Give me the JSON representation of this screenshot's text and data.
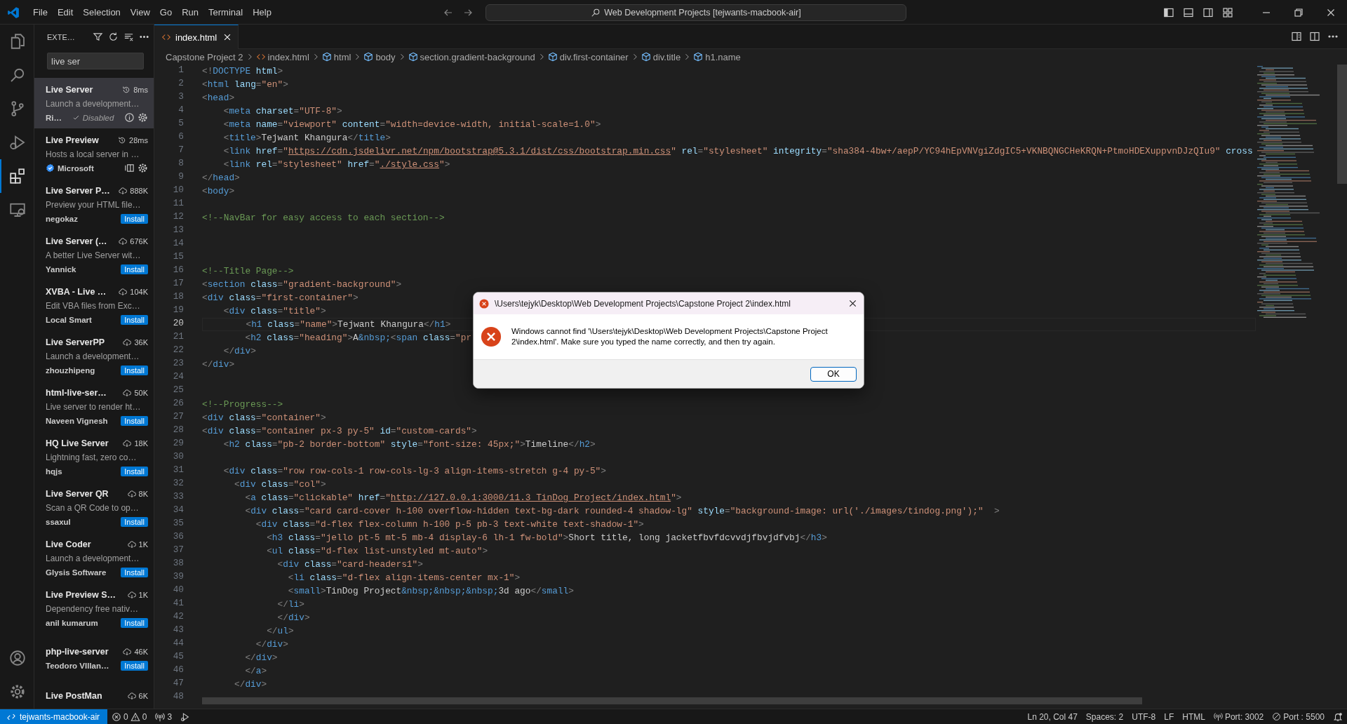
{
  "title_bar": {
    "menu": [
      "File",
      "Edit",
      "Selection",
      "View",
      "Go",
      "Run",
      "Terminal",
      "Help"
    ],
    "command_center": "Web Development Projects [tejwants-macbook-air]"
  },
  "activity_bar": [
    {
      "kind": "explorer",
      "selected": false
    },
    {
      "kind": "search",
      "selected": false
    },
    {
      "kind": "source-control",
      "selected": false
    },
    {
      "kind": "run-debug",
      "selected": false
    },
    {
      "kind": "extensions",
      "selected": true
    },
    {
      "kind": "remote",
      "selected": false
    }
  ],
  "activity_bar_bottom": [
    {
      "kind": "accounts"
    },
    {
      "kind": "settings"
    }
  ],
  "sidebar": {
    "title": "EXTE…",
    "search": {
      "value": "live ser"
    },
    "extensions": [
      {
        "name": "Live Server",
        "stat": "8ms",
        "description": "Launch a development…",
        "publisher": "Ri…",
        "kind": "disabled",
        "action": "Disabled",
        "selected": true,
        "verified": false
      },
      {
        "name": "Live Preview",
        "stat": "28ms",
        "description": "Hosts a local server in …",
        "publisher": "Microsoft",
        "kind": "installed",
        "selected": false,
        "verified": true
      },
      {
        "name": "Live Server P…",
        "stat": "888K",
        "description": "Preview your HTML file…",
        "publisher": "negokaz",
        "kind": "marketplace",
        "action": "Install",
        "selected": false,
        "verified": false
      },
      {
        "name": "Live Server (…",
        "stat": "676K",
        "description": "A better Live Server wit…",
        "publisher": "Yannick",
        "kind": "marketplace",
        "action": "Install",
        "selected": false,
        "verified": false
      },
      {
        "name": "XVBA - Live …",
        "stat": "104K",
        "description": "Edit VBA files from Exc…",
        "publisher": "Local Smart",
        "kind": "marketplace",
        "action": "Install",
        "selected": false,
        "verified": false
      },
      {
        "name": "Live ServerPP",
        "stat": "36K",
        "description": "Launch a development…",
        "publisher": "zhouzhipeng",
        "kind": "marketplace",
        "action": "Install",
        "selected": false,
        "verified": false
      },
      {
        "name": "html-live-ser…",
        "stat": "50K",
        "description": "Live server to render ht…",
        "publisher": "Naveen Vignesh",
        "kind": "marketplace",
        "action": "Install",
        "selected": false,
        "verified": false
      },
      {
        "name": "HQ Live Server",
        "stat": "18K",
        "description": "Lightning fast, zero co…",
        "publisher": "hqjs",
        "kind": "marketplace",
        "action": "Install",
        "selected": false,
        "verified": false
      },
      {
        "name": "Live Server QR",
        "stat": "8K",
        "description": "Scan a QR Code to op…",
        "publisher": "ssaxul",
        "kind": "marketplace",
        "action": "Install",
        "selected": false,
        "verified": false
      },
      {
        "name": "Live Coder",
        "stat": "1K",
        "description": "Launch a development…",
        "publisher": "Glysis Software",
        "kind": "marketplace",
        "action": "Install",
        "selected": false,
        "verified": false
      },
      {
        "name": "Live Preview S…",
        "stat": "1K",
        "description": "Dependency free nativ…",
        "publisher": "anil kumarum",
        "kind": "marketplace",
        "action": "Install",
        "selected": false,
        "verified": false
      },
      {
        "name": "php-live-server",
        "stat": "46K",
        "publisher": "Teodoro VIllan…",
        "kind": "marketplace",
        "action": "Install",
        "selected": false,
        "verified": false
      },
      {
        "name": "Live PostMan",
        "stat": "6K",
        "kind": "marketplace",
        "selected": false
      }
    ]
  },
  "editor": {
    "tab": {
      "label": "index.html",
      "selected": true
    },
    "breadcrumb": [
      {
        "kind": "folder",
        "label": "Capstone Project 2"
      },
      {
        "kind": "file",
        "label": "index.html"
      },
      {
        "kind": "symbol",
        "label": "html"
      },
      {
        "kind": "symbol",
        "label": "body"
      },
      {
        "kind": "symbol",
        "label": "section.gradient-background"
      },
      {
        "kind": "symbol",
        "label": "div.first-container"
      },
      {
        "kind": "symbol",
        "label": "div.title"
      },
      {
        "kind": "symbol",
        "label": "h1.name"
      }
    ],
    "lines": [
      {
        "number": "1",
        "current": false,
        "tokens": [
          {
            "kind": "punct",
            "text": "<!"
          },
          {
            "kind": "tag",
            "text": "DOCTYPE "
          },
          {
            "kind": "attr",
            "text": "html"
          },
          {
            "kind": "punct",
            "text": ">"
          }
        ]
      },
      {
        "number": "2",
        "current": false,
        "tokens": [
          {
            "kind": "punct",
            "text": "<"
          },
          {
            "kind": "tag",
            "text": "html "
          },
          {
            "kind": "attr",
            "text": "lang"
          },
          {
            "kind": "punct",
            "text": "="
          },
          {
            "kind": "string",
            "text": "\"en\""
          },
          {
            "kind": "punct",
            "text": ">"
          }
        ]
      },
      {
        "number": "3",
        "current": false,
        "tokens": [
          {
            "kind": "punct",
            "text": "<"
          },
          {
            "kind": "tag",
            "text": "head"
          },
          {
            "kind": "punct",
            "text": ">"
          }
        ]
      },
      {
        "number": "4",
        "current": false,
        "tokens": [
          {
            "kind": "punct",
            "text": "    <"
          },
          {
            "kind": "tag",
            "text": "meta "
          },
          {
            "kind": "attr",
            "text": "charset"
          },
          {
            "kind": "punct",
            "text": "="
          },
          {
            "kind": "string",
            "text": "\"UTF-8\""
          },
          {
            "kind": "punct",
            "text": ">"
          }
        ]
      },
      {
        "number": "5",
        "current": false,
        "tokens": [
          {
            "kind": "punct",
            "text": "    <"
          },
          {
            "kind": "tag",
            "text": "meta "
          },
          {
            "kind": "attr",
            "text": "name"
          },
          {
            "kind": "punct",
            "text": "="
          },
          {
            "kind": "string",
            "text": "\"viewport\" "
          },
          {
            "kind": "attr",
            "text": "content"
          },
          {
            "kind": "punct",
            "text": "="
          },
          {
            "kind": "string",
            "text": "\"width=device-width, initial-scale=1.0\""
          },
          {
            "kind": "punct",
            "text": ">"
          }
        ]
      },
      {
        "number": "6",
        "current": false,
        "tokens": [
          {
            "kind": "punct",
            "text": "    <"
          },
          {
            "kind": "tag",
            "text": "title"
          },
          {
            "kind": "punct",
            "text": ">"
          },
          {
            "kind": "text",
            "text": "Tejwant Khangura"
          },
          {
            "kind": "punct",
            "text": "</"
          },
          {
            "kind": "tag",
            "text": "title"
          },
          {
            "kind": "punct",
            "text": ">"
          }
        ]
      },
      {
        "number": "7",
        "current": false,
        "tokens": [
          {
            "kind": "punct",
            "text": "    <"
          },
          {
            "kind": "tag",
            "text": "link "
          },
          {
            "kind": "attr",
            "text": "href"
          },
          {
            "kind": "punct",
            "text": "="
          },
          {
            "kind": "string",
            "text": "\""
          },
          {
            "kind": "link",
            "text": "https://cdn.jsdelivr.net/npm/bootstrap@5.3.1/dist/css/bootstrap.min.css"
          },
          {
            "kind": "string",
            "text": "\" "
          },
          {
            "kind": "attr",
            "text": "rel"
          },
          {
            "kind": "punct",
            "text": "="
          },
          {
            "kind": "string",
            "text": "\"stylesheet\" "
          },
          {
            "kind": "attr",
            "text": "integrity"
          },
          {
            "kind": "punct",
            "text": "="
          },
          {
            "kind": "string",
            "text": "\"sha384-4bw+/aepP/YC94hEpVNVgiZdgIC5+VKNBQNGCHeKRQN+PtmoHDEXuppvnDJzQIu9\" "
          },
          {
            "kind": "attr",
            "text": "cross"
          }
        ]
      },
      {
        "number": "8",
        "current": false,
        "tokens": [
          {
            "kind": "punct",
            "text": "    <"
          },
          {
            "kind": "tag",
            "text": "link "
          },
          {
            "kind": "attr",
            "text": "rel"
          },
          {
            "kind": "punct",
            "text": "="
          },
          {
            "kind": "string",
            "text": "\"stylesheet\" "
          },
          {
            "kind": "attr",
            "text": "href"
          },
          {
            "kind": "punct",
            "text": "="
          },
          {
            "kind": "string",
            "text": "\""
          },
          {
            "kind": "link",
            "text": "./style.css"
          },
          {
            "kind": "string",
            "text": "\""
          },
          {
            "kind": "punct",
            "text": ">"
          }
        ]
      },
      {
        "number": "9",
        "current": false,
        "tokens": [
          {
            "kind": "punct",
            "text": "</"
          },
          {
            "kind": "tag",
            "text": "head"
          },
          {
            "kind": "punct",
            "text": ">"
          }
        ]
      },
      {
        "number": "10",
        "current": false,
        "tokens": [
          {
            "kind": "punct",
            "text": "<"
          },
          {
            "kind": "tag",
            "text": "body"
          },
          {
            "kind": "punct",
            "text": ">"
          }
        ]
      },
      {
        "number": "11",
        "current": false
      },
      {
        "number": "12",
        "current": false,
        "tokens": [
          {
            "kind": "comment",
            "text": "<!--NavBar for easy access to each section-->"
          }
        ]
      },
      {
        "number": "13",
        "current": false
      },
      {
        "number": "14",
        "current": false
      },
      {
        "number": "15",
        "current": false
      },
      {
        "number": "16",
        "current": false,
        "tokens": [
          {
            "kind": "comment",
            "text": "<!--Title Page-->"
          }
        ]
      },
      {
        "number": "17",
        "current": false,
        "tokens": [
          {
            "kind": "punct",
            "text": "<"
          },
          {
            "kind": "tag",
            "text": "section "
          },
          {
            "kind": "attr",
            "text": "class"
          },
          {
            "kind": "punct",
            "text": "="
          },
          {
            "kind": "string",
            "text": "\"gradient-background\""
          },
          {
            "kind": "punct",
            "text": ">"
          }
        ]
      },
      {
        "number": "18",
        "current": false,
        "tokens": [
          {
            "kind": "punct",
            "text": "<"
          },
          {
            "kind": "tag",
            "text": "div "
          },
          {
            "kind": "attr",
            "text": "class"
          },
          {
            "kind": "punct",
            "text": "="
          },
          {
            "kind": "string",
            "text": "\"first-container\""
          },
          {
            "kind": "punct",
            "text": ">"
          }
        ]
      },
      {
        "number": "19",
        "current": false,
        "tokens": [
          {
            "kind": "punct",
            "text": "    <"
          },
          {
            "kind": "tag",
            "text": "div "
          },
          {
            "kind": "attr",
            "text": "class"
          },
          {
            "kind": "punct",
            "text": "="
          },
          {
            "kind": "string",
            "text": "\"title\""
          },
          {
            "kind": "punct",
            "text": ">"
          }
        ]
      },
      {
        "number": "20",
        "current": true,
        "tokens": [
          {
            "kind": "punct",
            "text": "        <"
          },
          {
            "kind": "tag",
            "text": "h1 "
          },
          {
            "kind": "attr",
            "text": "class"
          },
          {
            "kind": "punct",
            "text": "="
          },
          {
            "kind": "string",
            "text": "\"name\""
          },
          {
            "kind": "punct",
            "text": ">"
          },
          {
            "kind": "text",
            "text": "Tejwant Khangura"
          },
          {
            "kind": "punct",
            "text": "</"
          },
          {
            "kind": "tag",
            "text": "h1"
          },
          {
            "kind": "punct",
            "text": ">"
          }
        ]
      },
      {
        "number": "21",
        "current": false,
        "tokens": [
          {
            "kind": "punct",
            "text": "        <"
          },
          {
            "kind": "tag",
            "text": "h2 "
          },
          {
            "kind": "attr",
            "text": "class"
          },
          {
            "kind": "punct",
            "text": "="
          },
          {
            "kind": "string",
            "text": "\"heading\""
          },
          {
            "kind": "punct",
            "text": ">"
          },
          {
            "kind": "text",
            "text": "A"
          },
          {
            "kind": "entity",
            "text": "&nbsp;"
          },
          {
            "kind": "punct",
            "text": "<"
          },
          {
            "kind": "tag",
            "text": "span "
          },
          {
            "kind": "attr",
            "text": "class"
          },
          {
            "kind": "punct",
            "text": "="
          },
          {
            "kind": "string",
            "text": "\"pr"
          }
        ]
      },
      {
        "number": "22",
        "current": false,
        "tokens": [
          {
            "kind": "punct",
            "text": "    </"
          },
          {
            "kind": "tag",
            "text": "div"
          },
          {
            "kind": "punct",
            "text": ">"
          }
        ]
      },
      {
        "number": "23",
        "current": false,
        "tokens": [
          {
            "kind": "punct",
            "text": "</"
          },
          {
            "kind": "tag",
            "text": "div"
          },
          {
            "kind": "punct",
            "text": ">"
          }
        ]
      },
      {
        "number": "24",
        "current": false
      },
      {
        "number": "25",
        "current": false
      },
      {
        "number": "26",
        "current": false,
        "tokens": [
          {
            "kind": "comment",
            "text": "<!--Progress-->"
          }
        ]
      },
      {
        "number": "27",
        "current": false,
        "tokens": [
          {
            "kind": "punct",
            "text": "<"
          },
          {
            "kind": "tag",
            "text": "div "
          },
          {
            "kind": "attr",
            "text": "class"
          },
          {
            "kind": "punct",
            "text": "="
          },
          {
            "kind": "string",
            "text": "\"container\""
          },
          {
            "kind": "punct",
            "text": ">"
          }
        ]
      },
      {
        "number": "28",
        "current": false,
        "tokens": [
          {
            "kind": "punct",
            "text": "<"
          },
          {
            "kind": "tag",
            "text": "div "
          },
          {
            "kind": "attr",
            "text": "class"
          },
          {
            "kind": "punct",
            "text": "="
          },
          {
            "kind": "string",
            "text": "\"container px-3 py-5\" "
          },
          {
            "kind": "attr",
            "text": "id"
          },
          {
            "kind": "punct",
            "text": "="
          },
          {
            "kind": "string",
            "text": "\"custom-cards\""
          },
          {
            "kind": "punct",
            "text": ">"
          }
        ]
      },
      {
        "number": "29",
        "current": false,
        "tokens": [
          {
            "kind": "punct",
            "text": "    <"
          },
          {
            "kind": "tag",
            "text": "h2 "
          },
          {
            "kind": "attr",
            "text": "class"
          },
          {
            "kind": "punct",
            "text": "="
          },
          {
            "kind": "string",
            "text": "\"pb-2 border-bottom\" "
          },
          {
            "kind": "attr",
            "text": "style"
          },
          {
            "kind": "punct",
            "text": "="
          },
          {
            "kind": "string",
            "text": "\"font-size: 45px;\""
          },
          {
            "kind": "punct",
            "text": ">"
          },
          {
            "kind": "text",
            "text": "Timeline"
          },
          {
            "kind": "punct",
            "text": "</"
          },
          {
            "kind": "tag",
            "text": "h2"
          },
          {
            "kind": "punct",
            "text": ">"
          }
        ]
      },
      {
        "number": "30",
        "current": false
      },
      {
        "number": "31",
        "current": false,
        "tokens": [
          {
            "kind": "punct",
            "text": "    <"
          },
          {
            "kind": "tag",
            "text": "div "
          },
          {
            "kind": "attr",
            "text": "class"
          },
          {
            "kind": "punct",
            "text": "="
          },
          {
            "kind": "string",
            "text": "\"row row-cols-1 row-cols-lg-3 align-items-stretch g-4 py-5\""
          },
          {
            "kind": "punct",
            "text": ">"
          }
        ]
      },
      {
        "number": "32",
        "current": false,
        "tokens": [
          {
            "kind": "punct",
            "text": "      <"
          },
          {
            "kind": "tag",
            "text": "div "
          },
          {
            "kind": "attr",
            "text": "class"
          },
          {
            "kind": "punct",
            "text": "="
          },
          {
            "kind": "string",
            "text": "\"col\""
          },
          {
            "kind": "punct",
            "text": ">"
          }
        ]
      },
      {
        "number": "33",
        "current": false,
        "tokens": [
          {
            "kind": "punct",
            "text": "        <"
          },
          {
            "kind": "tag",
            "text": "a "
          },
          {
            "kind": "attr",
            "text": "class"
          },
          {
            "kind": "punct",
            "text": "="
          },
          {
            "kind": "string",
            "text": "\"clickable\" "
          },
          {
            "kind": "attr",
            "text": "href"
          },
          {
            "kind": "punct",
            "text": "="
          },
          {
            "kind": "string",
            "text": "\""
          },
          {
            "kind": "link",
            "text": "http://127.0.0.1:3000/11.3 TinDog Project/index.html"
          },
          {
            "kind": "string",
            "text": "\""
          },
          {
            "kind": "punct",
            "text": ">"
          }
        ]
      },
      {
        "number": "34",
        "current": false,
        "tokens": [
          {
            "kind": "punct",
            "text": "        <"
          },
          {
            "kind": "tag",
            "text": "div "
          },
          {
            "kind": "attr",
            "text": "class"
          },
          {
            "kind": "punct",
            "text": "="
          },
          {
            "kind": "string",
            "text": "\"card card-cover h-100 overflow-hidden text-bg-dark rounded-4 shadow-lg\" "
          },
          {
            "kind": "attr",
            "text": "style"
          },
          {
            "kind": "punct",
            "text": "="
          },
          {
            "kind": "string",
            "text": "\"background-image: url('./images/tindog.png');\""
          },
          {
            "kind": "punct",
            "text": "  >"
          }
        ]
      },
      {
        "number": "35",
        "current": false,
        "tokens": [
          {
            "kind": "punct",
            "text": "          <"
          },
          {
            "kind": "tag",
            "text": "div "
          },
          {
            "kind": "attr",
            "text": "class"
          },
          {
            "kind": "punct",
            "text": "="
          },
          {
            "kind": "string",
            "text": "\"d-flex flex-column h-100 p-5 pb-3 text-white text-shadow-1\""
          },
          {
            "kind": "punct",
            "text": ">"
          }
        ]
      },
      {
        "number": "36",
        "current": false,
        "tokens": [
          {
            "kind": "punct",
            "text": "            <"
          },
          {
            "kind": "tag",
            "text": "h3 "
          },
          {
            "kind": "attr",
            "text": "class"
          },
          {
            "kind": "punct",
            "text": "="
          },
          {
            "kind": "string",
            "text": "\"jello pt-5 mt-5 mb-4 display-6 lh-1 fw-bold\""
          },
          {
            "kind": "punct",
            "text": ">"
          },
          {
            "kind": "text",
            "text": "Short title, long jacketfbvfdcvvdjfbvjdfvbj"
          },
          {
            "kind": "punct",
            "text": "</"
          },
          {
            "kind": "tag",
            "text": "h3"
          },
          {
            "kind": "punct",
            "text": ">"
          }
        ]
      },
      {
        "number": "37",
        "current": false,
        "tokens": [
          {
            "kind": "punct",
            "text": "            <"
          },
          {
            "kind": "tag",
            "text": "ul "
          },
          {
            "kind": "attr",
            "text": "class"
          },
          {
            "kind": "punct",
            "text": "="
          },
          {
            "kind": "string",
            "text": "\"d-flex list-unstyled mt-auto\""
          },
          {
            "kind": "punct",
            "text": ">"
          }
        ]
      },
      {
        "number": "38",
        "current": false,
        "tokens": [
          {
            "kind": "punct",
            "text": "              <"
          },
          {
            "kind": "tag",
            "text": "div "
          },
          {
            "kind": "attr",
            "text": "class"
          },
          {
            "kind": "punct",
            "text": "="
          },
          {
            "kind": "string",
            "text": "\"card-headers1\""
          },
          {
            "kind": "punct",
            "text": ">"
          }
        ]
      },
      {
        "number": "39",
        "current": false,
        "tokens": [
          {
            "kind": "punct",
            "text": "                <"
          },
          {
            "kind": "tag",
            "text": "li "
          },
          {
            "kind": "attr",
            "text": "class"
          },
          {
            "kind": "punct",
            "text": "="
          },
          {
            "kind": "string",
            "text": "\"d-flex align-items-center mx-1\""
          },
          {
            "kind": "punct",
            "text": ">"
          }
        ]
      },
      {
        "number": "40",
        "current": false,
        "tokens": [
          {
            "kind": "punct",
            "text": "                <"
          },
          {
            "kind": "tag",
            "text": "small"
          },
          {
            "kind": "punct",
            "text": ">"
          },
          {
            "kind": "text",
            "text": "TinDog Project"
          },
          {
            "kind": "entity",
            "text": "&nbsp;&nbsp;&nbsp;"
          },
          {
            "kind": "text",
            "text": "3d ago"
          },
          {
            "kind": "punct",
            "text": "</"
          },
          {
            "kind": "tag",
            "text": "small"
          },
          {
            "kind": "punct",
            "text": ">"
          }
        ]
      },
      {
        "number": "41",
        "current": false,
        "tokens": [
          {
            "kind": "punct",
            "text": "              </"
          },
          {
            "kind": "tag",
            "text": "li"
          },
          {
            "kind": "punct",
            "text": ">"
          }
        ]
      },
      {
        "number": "42",
        "current": false,
        "tokens": [
          {
            "kind": "punct",
            "text": "              </"
          },
          {
            "kind": "tag",
            "text": "div"
          },
          {
            "kind": "punct",
            "text": ">"
          }
        ]
      },
      {
        "number": "43",
        "current": false,
        "tokens": [
          {
            "kind": "punct",
            "text": "            </"
          },
          {
            "kind": "tag",
            "text": "ul"
          },
          {
            "kind": "punct",
            "text": ">"
          }
        ]
      },
      {
        "number": "44",
        "current": false,
        "tokens": [
          {
            "kind": "punct",
            "text": "          </"
          },
          {
            "kind": "tag",
            "text": "div"
          },
          {
            "kind": "punct",
            "text": ">"
          }
        ]
      },
      {
        "number": "45",
        "current": false,
        "tokens": [
          {
            "kind": "punct",
            "text": "        </"
          },
          {
            "kind": "tag",
            "text": "div"
          },
          {
            "kind": "punct",
            "text": ">"
          }
        ]
      },
      {
        "number": "46",
        "current": false,
        "tokens": [
          {
            "kind": "punct",
            "text": "        </"
          },
          {
            "kind": "tag",
            "text": "a"
          },
          {
            "kind": "punct",
            "text": ">"
          }
        ]
      },
      {
        "number": "47",
        "current": false,
        "tokens": [
          {
            "kind": "punct",
            "text": "      </"
          },
          {
            "kind": "tag",
            "text": "div"
          },
          {
            "kind": "punct",
            "text": ">"
          }
        ]
      },
      {
        "number": "48",
        "current": false
      }
    ]
  },
  "dialog": {
    "title": "\\Users\\tejyk\\Desktop\\Web Development Projects\\Capstone Project 2\\index.html",
    "message": "Windows cannot find '\\Users\\tejyk\\Desktop\\Web Development Projects\\Capstone Project 2\\index.html'. Make sure you typed the name correctly, and then try again.",
    "button": "OK"
  },
  "status_bar": {
    "remote": "tejwants-macbook-air",
    "errors": "0",
    "warnings": "0",
    "ports": "3",
    "items": [
      {
        "kind": "text",
        "label": "Ln 20, Col 47"
      },
      {
        "kind": "text",
        "label": "Spaces: 2"
      },
      {
        "kind": "text",
        "label": "UTF-8"
      },
      {
        "kind": "text",
        "label": "LF"
      },
      {
        "kind": "text",
        "label": "HTML"
      },
      {
        "kind": "port",
        "label": "Port: 3002"
      },
      {
        "kind": "port-off",
        "label": "Port : 5500"
      }
    ]
  }
}
